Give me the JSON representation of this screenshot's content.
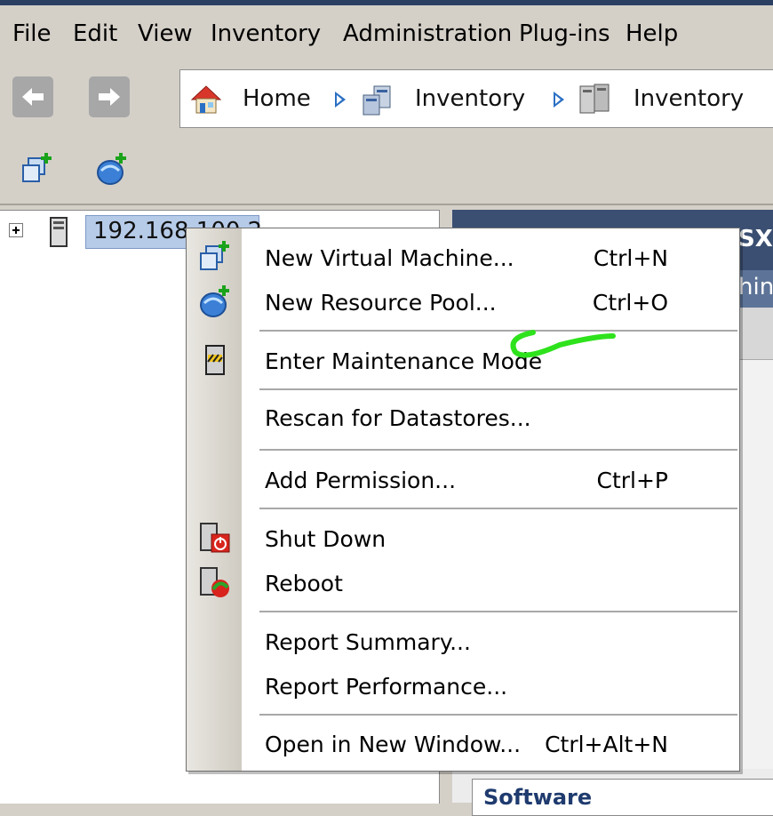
{
  "menubar": [
    "File",
    "Edit",
    "View",
    "Inventory",
    "Administration",
    "Plug-ins",
    "Help"
  ],
  "nav": {
    "back_icon": "back-arrow-icon",
    "forward_icon": "forward-arrow-icon"
  },
  "breadcrumb": {
    "home": "Home",
    "item1": "Inventory",
    "item2": "Inventory"
  },
  "toolbar": {
    "icons": [
      "new-vm-icon",
      "new-resource-pool-icon"
    ]
  },
  "tree": {
    "host": "192.168.100.2"
  },
  "right_pane": {
    "header_fragment": "SX",
    "tab_fragment": "hin",
    "box_fragment": "Software"
  },
  "context_menu": {
    "new_vm": "New Virtual Machine...",
    "new_vm_shortcut": "Ctrl+N",
    "new_pool": "New Resource Pool...",
    "new_pool_shortcut": "Ctrl+O",
    "maintenance": "Enter Maintenance Mode",
    "rescan": "Rescan for Datastores...",
    "add_permission": "Add Permission...",
    "add_permission_shortcut": "Ctrl+P",
    "shut_down": "Shut Down",
    "reboot": "Reboot",
    "report_summary": "Report Summary...",
    "report_performance": "Report Performance...",
    "open_new_window": "Open in New Window...",
    "open_new_window_shortcut": "Ctrl+Alt+N"
  },
  "colors": {
    "highlight_scribble": "#2ee21c",
    "selection": "#b6cbe8",
    "header": "#3b4f72"
  }
}
